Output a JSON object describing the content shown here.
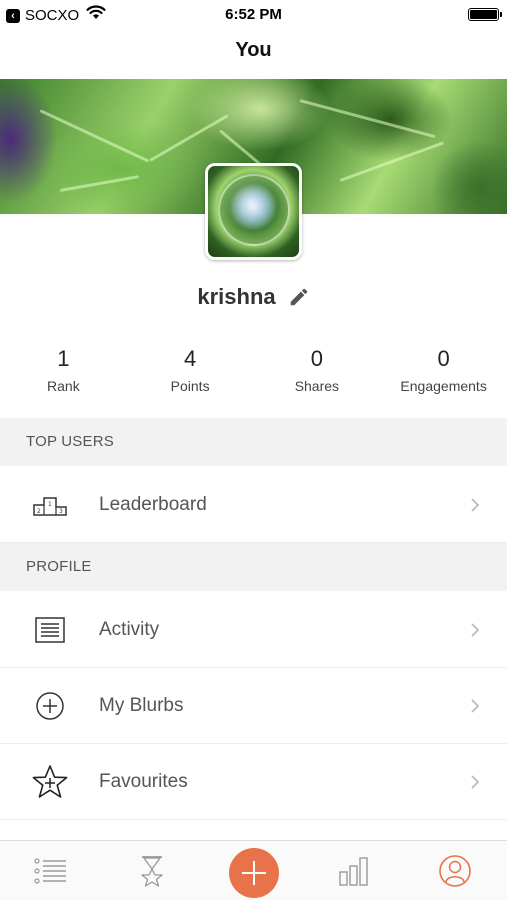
{
  "status_bar": {
    "back_app": "SOCXO",
    "time": "6:52 PM"
  },
  "nav": {
    "title": "You"
  },
  "profile": {
    "username": "krishna",
    "stats": [
      {
        "value": "1",
        "label": "Rank"
      },
      {
        "value": "4",
        "label": "Points"
      },
      {
        "value": "0",
        "label": "Shares"
      },
      {
        "value": "0",
        "label": "Engagements"
      }
    ]
  },
  "sections": {
    "top_users": {
      "header": "TOP USERS",
      "items": [
        {
          "label": "Leaderboard",
          "icon": "podium-icon"
        }
      ]
    },
    "profile": {
      "header": "PROFILE",
      "items": [
        {
          "label": "Activity",
          "icon": "list-icon"
        },
        {
          "label": "My Blurbs",
          "icon": "plus-circle-icon"
        },
        {
          "label": "Favourites",
          "icon": "star-plus-icon"
        }
      ]
    }
  },
  "tabbar": {
    "tabs": [
      {
        "icon": "feed-list-icon"
      },
      {
        "icon": "hourglass-star-icon"
      },
      {
        "icon": "add-icon"
      },
      {
        "icon": "bar-chart-icon"
      },
      {
        "icon": "profile-icon",
        "active": true
      }
    ],
    "accent": "#e8734a",
    "inactive": "#9a9a9a"
  }
}
